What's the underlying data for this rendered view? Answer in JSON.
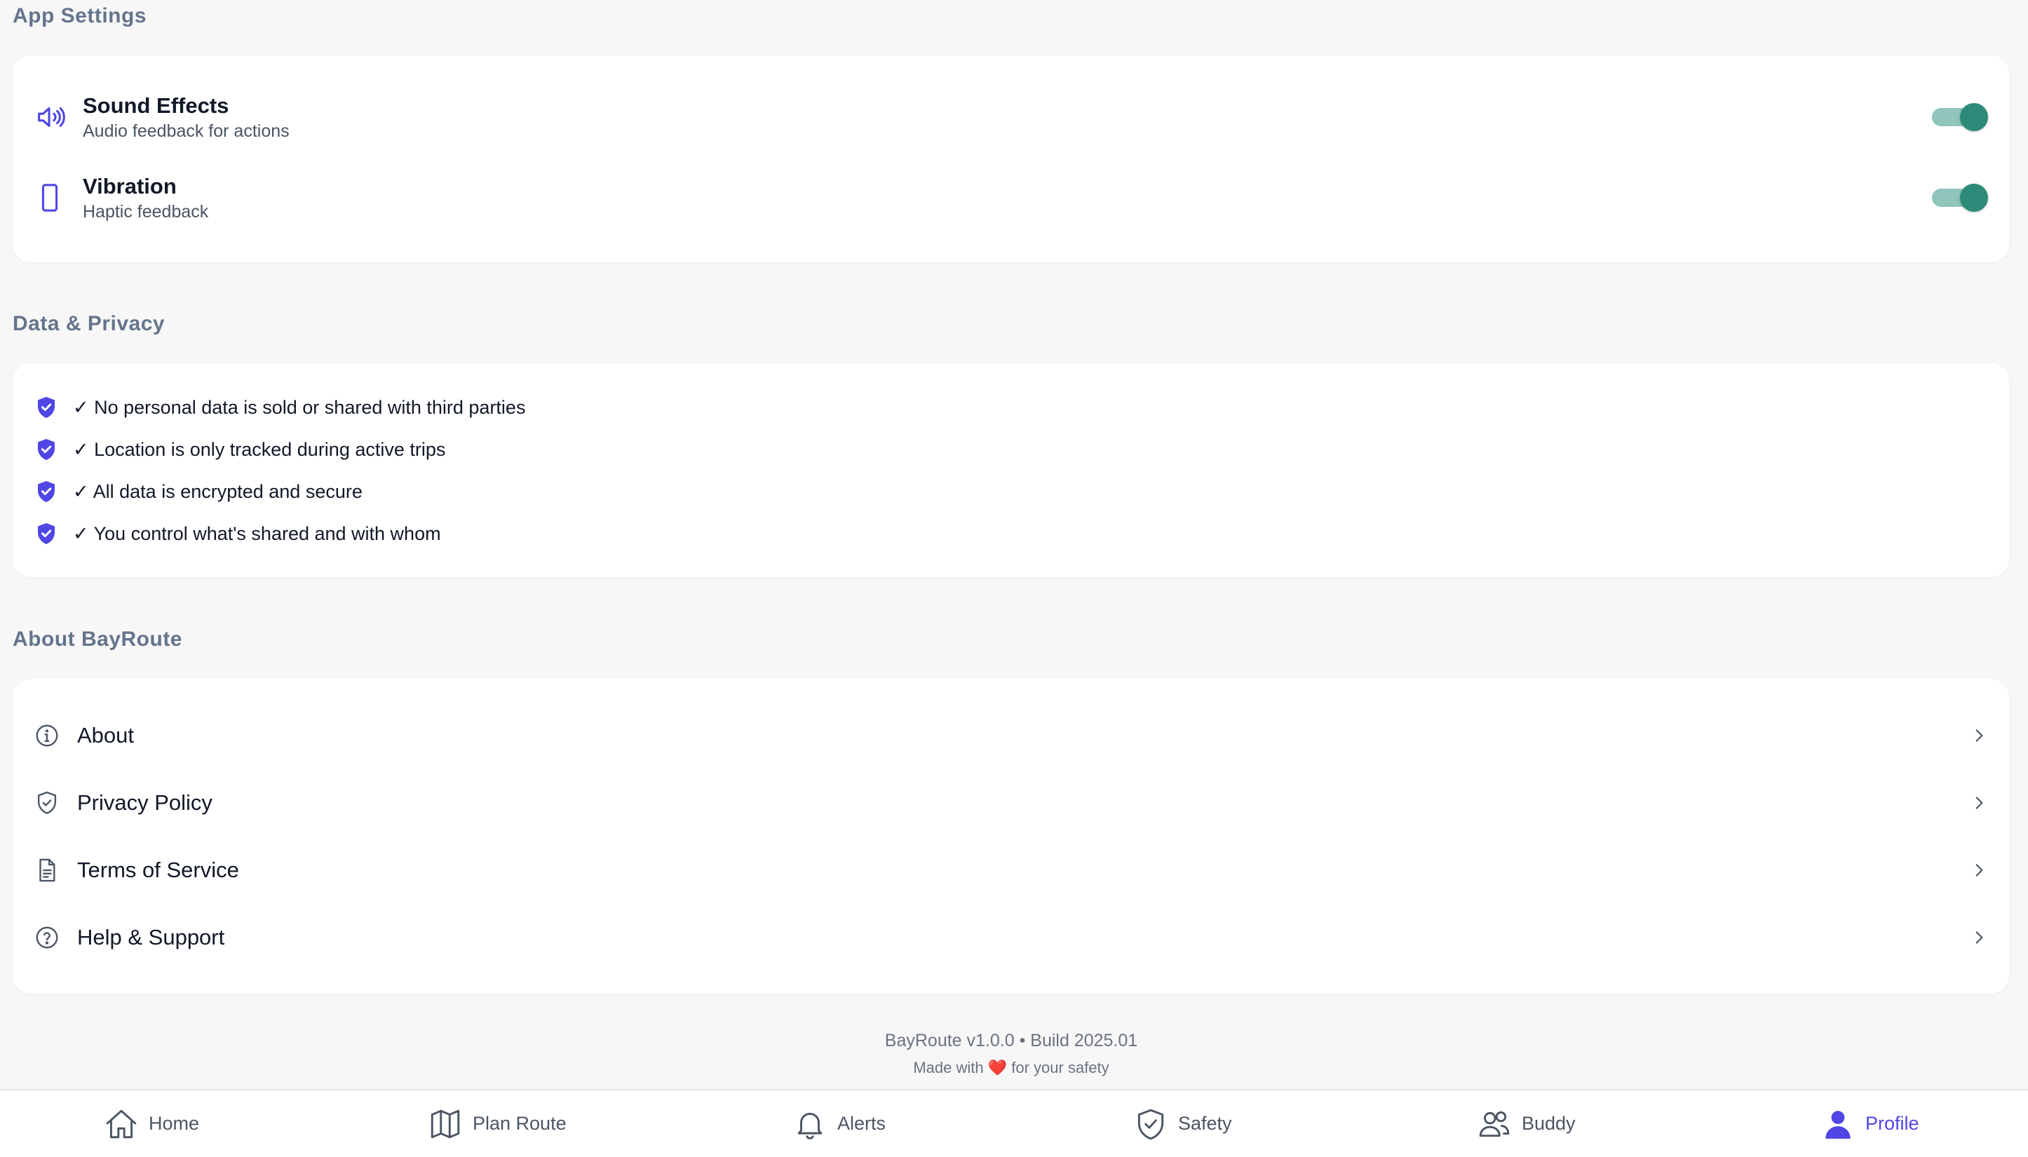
{
  "app_settings": {
    "title": "App Settings",
    "items": [
      {
        "icon": "speaker-icon",
        "title": "Sound Effects",
        "subtitle": "Audio feedback for actions",
        "enabled": true
      },
      {
        "icon": "phone-icon",
        "title": "Vibration",
        "subtitle": "Haptic feedback",
        "enabled": true
      }
    ]
  },
  "privacy": {
    "title": "Data & Privacy",
    "items": [
      "✓ No personal data is sold or shared with third parties",
      "✓ Location is only tracked during active trips",
      "✓ All data is encrypted and secure",
      "✓ You control what's shared and with whom"
    ]
  },
  "about": {
    "title": "About BayRoute",
    "links": [
      {
        "icon": "info-icon",
        "label": "About"
      },
      {
        "icon": "shield-check-icon",
        "label": "Privacy Policy"
      },
      {
        "icon": "document-icon",
        "label": "Terms of Service"
      },
      {
        "icon": "question-icon",
        "label": "Help & Support"
      }
    ]
  },
  "footer": {
    "version": "BayRoute v1.0.0 • Build 2025.01",
    "made_prefix": "Made with",
    "heart": "❤️",
    "made_suffix": "for your safety"
  },
  "nav": {
    "items": [
      {
        "icon": "home-icon",
        "label": "Home",
        "active": false
      },
      {
        "icon": "map-icon",
        "label": "Plan Route",
        "active": false
      },
      {
        "icon": "bell-icon",
        "label": "Alerts",
        "active": false
      },
      {
        "icon": "shield-icon",
        "label": "Safety",
        "active": false
      },
      {
        "icon": "buddy-icon",
        "label": "Buddy",
        "active": false
      },
      {
        "icon": "user-icon",
        "label": "Profile",
        "active": true
      }
    ]
  },
  "colors": {
    "accent": "#4f46e5",
    "toggle_on": "#2d8a79",
    "toggle_track": "#8fc5bb",
    "section_title": "#64748b"
  }
}
